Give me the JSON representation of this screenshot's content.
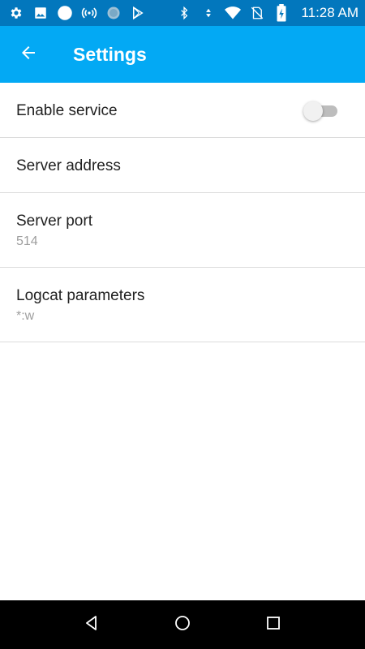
{
  "status_bar": {
    "time": "11:28 AM",
    "left_icons": [
      "gear-icon",
      "image-icon",
      "circle-icon",
      "wireless-icon",
      "sync-icon",
      "play-store-icon"
    ],
    "right_icons": [
      "bluetooth-icon",
      "data-arrows-icon",
      "wifi-icon",
      "no-sim-icon",
      "battery-charging-icon"
    ],
    "color": "#0277bd"
  },
  "app_bar": {
    "title": "Settings",
    "back_icon": "arrow-left-icon",
    "color": "#03a9f4"
  },
  "preferences": [
    {
      "title": "Enable service",
      "summary": "",
      "widget": "switch",
      "switch_on": false
    },
    {
      "title": "Server address",
      "summary": ""
    },
    {
      "title": "Server port",
      "summary": "514"
    },
    {
      "title": "Logcat parameters",
      "summary": "*:w"
    }
  ],
  "nav_bar": {
    "buttons": [
      "back-triangle-icon",
      "home-circle-icon",
      "recents-square-icon"
    ]
  }
}
